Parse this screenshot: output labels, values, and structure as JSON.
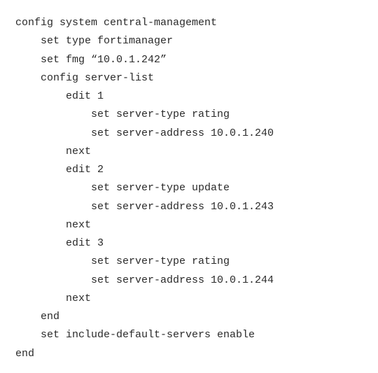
{
  "lines": [
    "config system central-management",
    "    set type fortimanager",
    "    set fmg “10.0.1.242”",
    "    config server-list",
    "        edit 1",
    "            set server-type rating",
    "            set server-address 10.0.1.240",
    "        next",
    "        edit 2",
    "            set server-type update",
    "            set server-address 10.0.1.243",
    "        next",
    "        edit 3",
    "            set server-type rating",
    "            set server-address 10.0.1.244",
    "        next",
    "    end",
    "    set include-default-servers enable",
    "end"
  ]
}
